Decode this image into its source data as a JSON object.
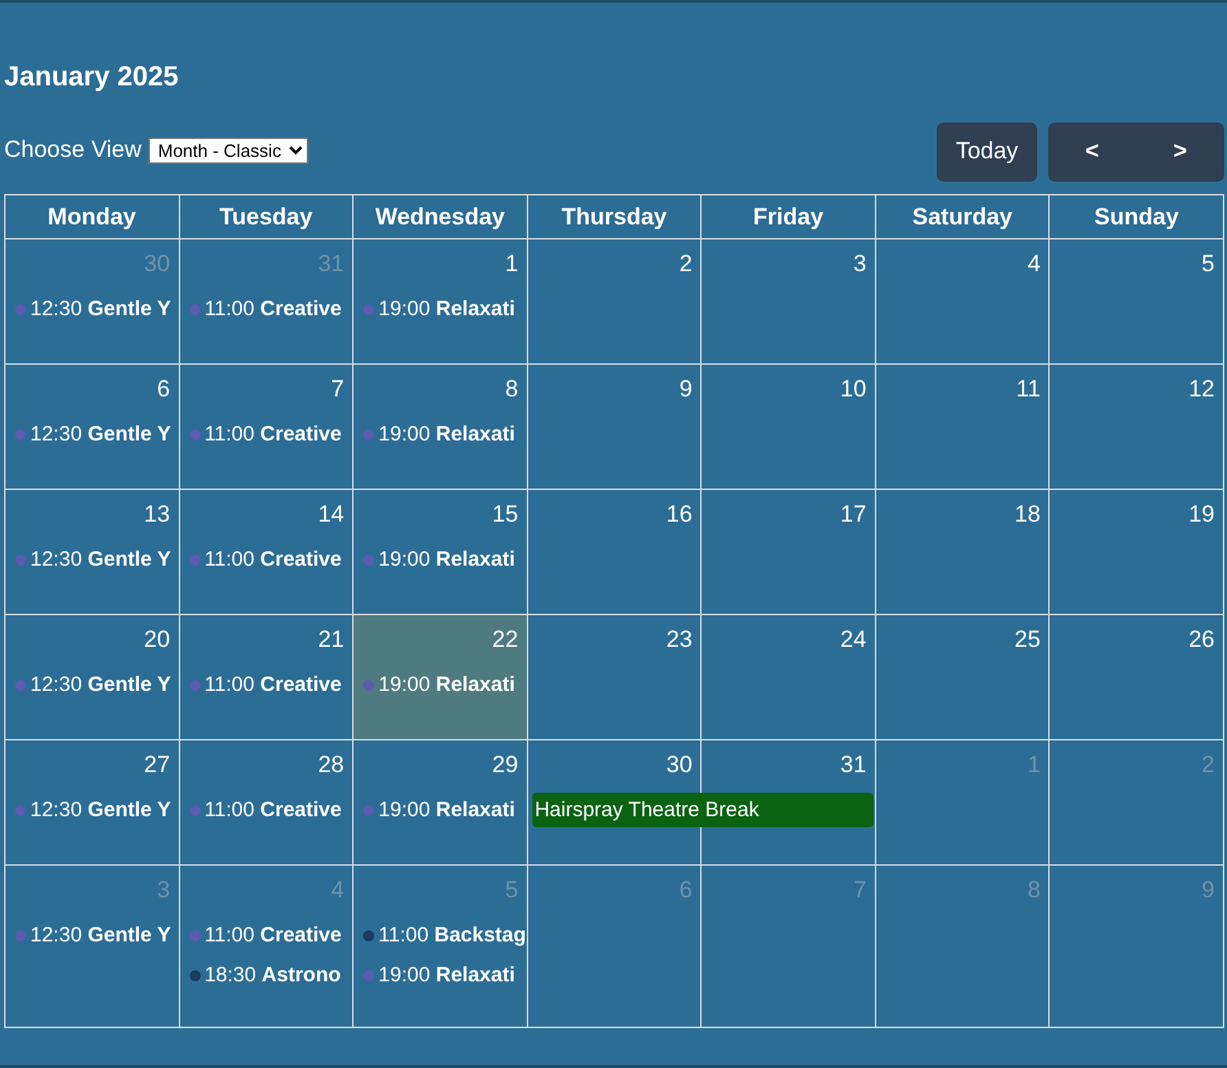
{
  "title": "January 2025",
  "view": {
    "label": "Choose View",
    "value": "Month - Classic"
  },
  "buttons": {
    "today": "Today",
    "prev": "<",
    "next": ">"
  },
  "weekdays": [
    "Monday",
    "Tuesday",
    "Wednesday",
    "Thursday",
    "Friday",
    "Saturday",
    "Sunday"
  ],
  "weeks": [
    {
      "days": [
        {
          "date": "30",
          "other_month": true,
          "today": false,
          "events": [
            {
              "kind": "timed",
              "time": "12:30",
              "title": "Gentle Y",
              "color": "#5b5bb0"
            }
          ]
        },
        {
          "date": "31",
          "other_month": true,
          "today": false,
          "events": [
            {
              "kind": "timed",
              "time": "11:00",
              "title": "Creative",
              "color": "#5b5bb0"
            }
          ]
        },
        {
          "date": "1",
          "other_month": false,
          "today": false,
          "events": [
            {
              "kind": "timed",
              "time": "19:00",
              "title": "Relaxati",
              "color": "#5b5bb0"
            }
          ]
        },
        {
          "date": "2",
          "other_month": false,
          "today": false
        },
        {
          "date": "3",
          "other_month": false,
          "today": false
        },
        {
          "date": "4",
          "other_month": false,
          "today": false
        },
        {
          "date": "5",
          "other_month": false,
          "today": false
        }
      ]
    },
    {
      "days": [
        {
          "date": "6",
          "other_month": false,
          "today": false,
          "events": [
            {
              "kind": "timed",
              "time": "12:30",
              "title": "Gentle Y",
              "color": "#5b5bb0"
            }
          ]
        },
        {
          "date": "7",
          "other_month": false,
          "today": false,
          "events": [
            {
              "kind": "timed",
              "time": "11:00",
              "title": "Creative",
              "color": "#5b5bb0"
            }
          ]
        },
        {
          "date": "8",
          "other_month": false,
          "today": false,
          "events": [
            {
              "kind": "timed",
              "time": "19:00",
              "title": "Relaxati",
              "color": "#5b5bb0"
            }
          ]
        },
        {
          "date": "9",
          "other_month": false,
          "today": false
        },
        {
          "date": "10",
          "other_month": false,
          "today": false
        },
        {
          "date": "11",
          "other_month": false,
          "today": false
        },
        {
          "date": "12",
          "other_month": false,
          "today": false
        }
      ]
    },
    {
      "days": [
        {
          "date": "13",
          "other_month": false,
          "today": false,
          "events": [
            {
              "kind": "timed",
              "time": "12:30",
              "title": "Gentle Y",
              "color": "#5b5bb0"
            }
          ]
        },
        {
          "date": "14",
          "other_month": false,
          "today": false,
          "events": [
            {
              "kind": "timed",
              "time": "11:00",
              "title": "Creative",
              "color": "#5b5bb0"
            }
          ]
        },
        {
          "date": "15",
          "other_month": false,
          "today": false,
          "events": [
            {
              "kind": "timed",
              "time": "19:00",
              "title": "Relaxati",
              "color": "#5b5bb0"
            }
          ]
        },
        {
          "date": "16",
          "other_month": false,
          "today": false
        },
        {
          "date": "17",
          "other_month": false,
          "today": false
        },
        {
          "date": "18",
          "other_month": false,
          "today": false
        },
        {
          "date": "19",
          "other_month": false,
          "today": false
        }
      ]
    },
    {
      "days": [
        {
          "date": "20",
          "other_month": false,
          "today": false,
          "events": [
            {
              "kind": "timed",
              "time": "12:30",
              "title": "Gentle Y",
              "color": "#5b5bb0"
            }
          ]
        },
        {
          "date": "21",
          "other_month": false,
          "today": false,
          "events": [
            {
              "kind": "timed",
              "time": "11:00",
              "title": "Creative",
              "color": "#5b5bb0"
            }
          ]
        },
        {
          "date": "22",
          "other_month": false,
          "today": true,
          "events": [
            {
              "kind": "timed",
              "time": "19:00",
              "title": "Relaxati",
              "color": "#5b5bb0"
            }
          ]
        },
        {
          "date": "23",
          "other_month": false,
          "today": false
        },
        {
          "date": "24",
          "other_month": false,
          "today": false
        },
        {
          "date": "25",
          "other_month": false,
          "today": false
        },
        {
          "date": "26",
          "other_month": false,
          "today": false
        }
      ]
    },
    {
      "days": [
        {
          "date": "27",
          "other_month": false,
          "today": false,
          "events": [
            {
              "kind": "timed",
              "time": "12:30",
              "title": "Gentle Y",
              "color": "#5b5bb0"
            }
          ]
        },
        {
          "date": "28",
          "other_month": false,
          "today": false,
          "events": [
            {
              "kind": "timed",
              "time": "11:00",
              "title": "Creative",
              "color": "#5b5bb0"
            }
          ]
        },
        {
          "date": "29",
          "other_month": false,
          "today": false,
          "events": [
            {
              "kind": "timed",
              "time": "19:00",
              "title": "Relaxati",
              "color": "#5b5bb0"
            }
          ]
        },
        {
          "date": "30",
          "other_month": false,
          "today": false,
          "events": [
            {
              "kind": "banner",
              "title": "Hairspray Theatre Break",
              "color": "#0b6312"
            }
          ]
        },
        {
          "date": "31",
          "other_month": false,
          "today": false,
          "banner_continues": true
        },
        {
          "date": "1",
          "other_month": true,
          "today": false
        },
        {
          "date": "2",
          "other_month": true,
          "today": false
        }
      ]
    },
    {
      "days": [
        {
          "date": "3",
          "other_month": true,
          "today": false,
          "events": [
            {
              "kind": "timed",
              "time": "12:30",
              "title": "Gentle Y",
              "color": "#5b5bb0"
            }
          ]
        },
        {
          "date": "4",
          "other_month": true,
          "today": false,
          "events": [
            {
              "kind": "timed",
              "time": "11:00",
              "title": "Creative",
              "color": "#5b5bb0"
            },
            {
              "kind": "timed",
              "time": "18:30",
              "title": "Astrono",
              "color": "#1b3a5c"
            }
          ]
        },
        {
          "date": "5",
          "other_month": true,
          "today": false,
          "events": [
            {
              "kind": "timed",
              "time": "11:00",
              "title": "Backstag",
              "color": "#1b3a5c"
            },
            {
              "kind": "timed",
              "time": "19:00",
              "title": "Relaxati",
              "color": "#5b5bb0"
            }
          ]
        },
        {
          "date": "6",
          "other_month": true,
          "today": false
        },
        {
          "date": "7",
          "other_month": true,
          "today": false
        },
        {
          "date": "8",
          "other_month": true,
          "today": false
        },
        {
          "date": "9",
          "other_month": true,
          "today": false
        }
      ]
    }
  ]
}
